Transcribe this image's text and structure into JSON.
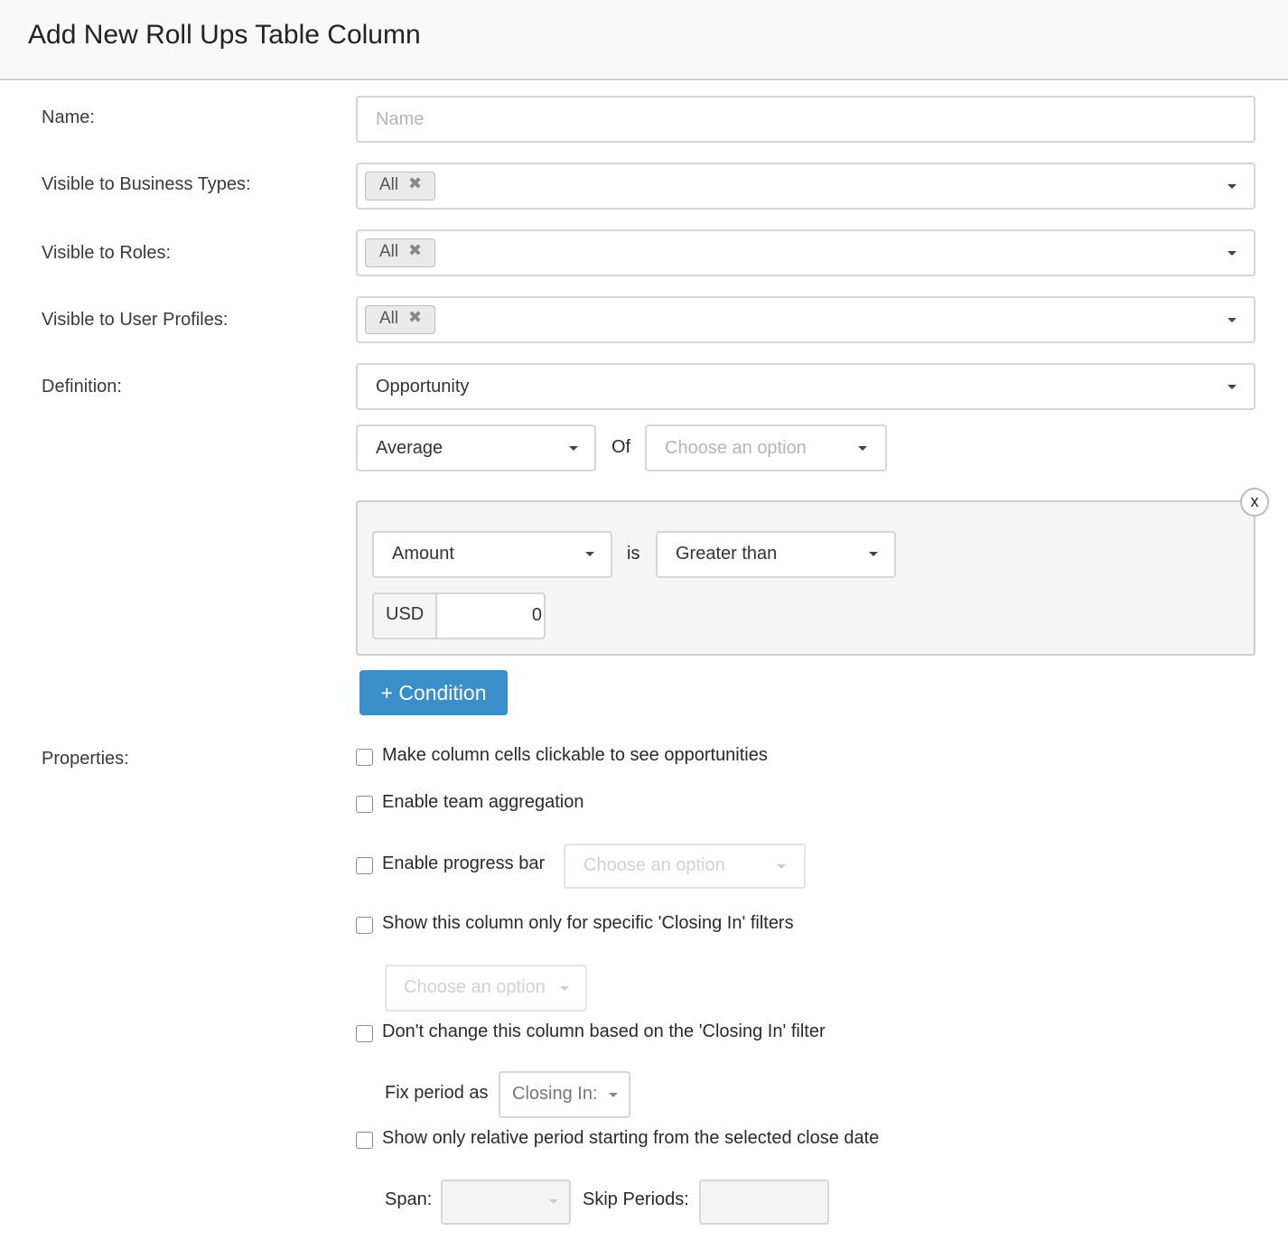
{
  "header": {
    "title": "Add New Roll Ups Table Column"
  },
  "name_field": {
    "label": "Name:",
    "placeholder": "Name"
  },
  "business_types": {
    "label": "Visible to Business Types:",
    "tag": "All",
    "tag_remove": "✖"
  },
  "roles": {
    "label": "Visible to Roles:",
    "tag": "All",
    "tag_remove": "✖"
  },
  "user_profiles": {
    "label": "Visible to User Profiles:",
    "tag": "All",
    "tag_remove": "✖"
  },
  "definition": {
    "label": "Definition:",
    "value": "Opportunity",
    "aggregate": "Average",
    "of_label": "Of",
    "of_placeholder": "Choose an option"
  },
  "condition": {
    "field": "Amount",
    "is_label": "is",
    "operator": "Greater than",
    "currency": "USD",
    "value": "0",
    "remove_label": "x",
    "add_button": "+ Condition"
  },
  "properties": {
    "label": "Properties:",
    "clickable_label": "Make column cells clickable to see opportunities",
    "team_aggregation_label": "Enable team aggregation",
    "progress_bar_label": "Enable progress bar",
    "progress_bar_placeholder": "Choose an option",
    "closing_in_label": "Show this column only for specific 'Closing In' filters",
    "closing_in_placeholder": "Choose an option",
    "dont_change_label": "Don't change this column based on the 'Closing In' filter",
    "fix_period_label": "Fix period as",
    "fix_period_value": "Closing In:",
    "relative_period_label": "Show only relative period starting from the selected close date",
    "span_label": "Span:",
    "span_value": "",
    "skip_periods_label": "Skip Periods:",
    "skip_periods_value": ""
  }
}
